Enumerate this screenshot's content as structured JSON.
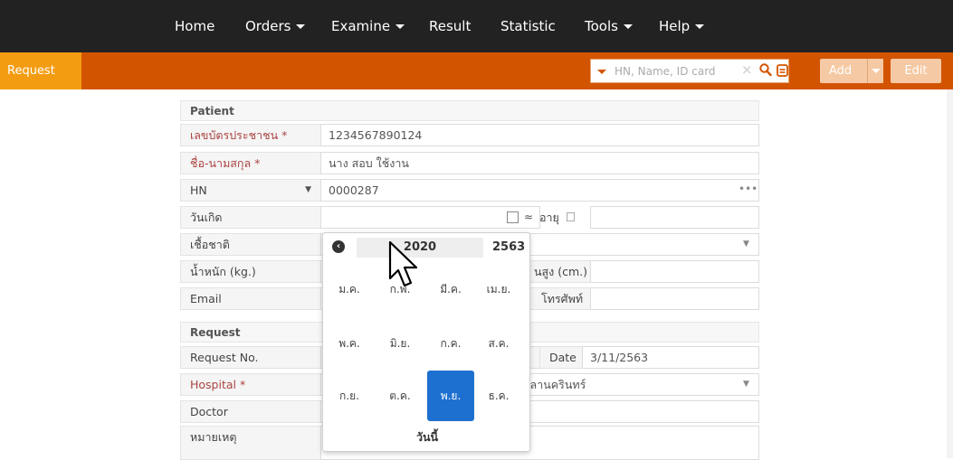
{
  "nav": {
    "items": [
      {
        "label": "Home",
        "dropdown": false
      },
      {
        "label": "Orders",
        "dropdown": true
      },
      {
        "label": "Examine",
        "dropdown": true
      },
      {
        "label": "Result",
        "dropdown": false
      },
      {
        "label": "Statistic",
        "dropdown": false
      },
      {
        "label": "Tools",
        "dropdown": true
      },
      {
        "label": "Help",
        "dropdown": true
      }
    ]
  },
  "toolbar": {
    "tab_label": "Request",
    "search_placeholder": "HN, Name, ID card",
    "add_label": "Add",
    "edit_label": "Edit"
  },
  "patient": {
    "title": "Patient",
    "id_card_label": "เลขบัตรประชาชน *",
    "id_card_value": "1234567890124",
    "name_label": "ชื่อ-นามสกุล *",
    "name_value": "นาง สอบ ใช้งาน",
    "hn_label": "HN",
    "hn_value": "0000287",
    "birthdate_label": "วันเกิด",
    "approx_symbol": "≈",
    "age_label": "อายุ",
    "nationality_label": "เชื้อชาติ",
    "weight_label": "น้ำหนัก (kg.)",
    "height_label": "นสูง (cm.)",
    "email_label": "Email",
    "phone_label": "โทรศัพท์"
  },
  "request": {
    "title": "Request",
    "request_no_label": "Request No.",
    "date_label": "Date",
    "date_value": "3/11/2563",
    "hospital_label": "Hospital *",
    "hospital_value": "ขลานครินทร์",
    "doctor_label": "Doctor",
    "note_label": "หมายเหตุ"
  },
  "datepicker": {
    "year": "2020",
    "year_th": "2563",
    "months": [
      "ม.ค.",
      "ก.พ.",
      "มี.ค.",
      "เม.ย.",
      "พ.ค.",
      "มิ.ย.",
      "ก.ค.",
      "ส.ค.",
      "ก.ย.",
      "ต.ค.",
      "พ.ย.",
      "ธ.ค."
    ],
    "selected_month": "พ.ย.",
    "today_label": "วันนี้"
  },
  "colors": {
    "navbar": "#222222",
    "toolbar": "#d35400",
    "tab": "#f39c12",
    "selected": "#1e70d0"
  }
}
